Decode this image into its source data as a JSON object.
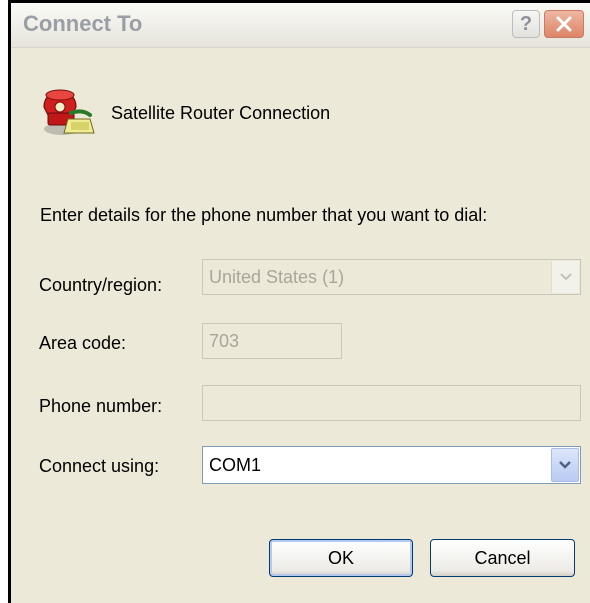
{
  "window": {
    "title": "Connect To"
  },
  "connection": {
    "name": "Satellite Router Connection",
    "icon": "phone-icon"
  },
  "prompt": "Enter details for the phone number that you want to dial:",
  "fields": {
    "country": {
      "label": "Country/region:",
      "value": "United States (1)",
      "enabled": false
    },
    "area_code": {
      "label": "Area code:",
      "value": "703",
      "enabled": false
    },
    "phone": {
      "label": "Phone number:",
      "value": "",
      "enabled": false
    },
    "connect_using": {
      "label": "Connect using:",
      "value": "COM1",
      "enabled": true
    }
  },
  "buttons": {
    "ok": "OK",
    "cancel": "Cancel",
    "help": "?"
  },
  "colors": {
    "close_button": "#dd8466",
    "title_text": "#9a9ea5",
    "dialog_bg": "#ece9d8"
  }
}
